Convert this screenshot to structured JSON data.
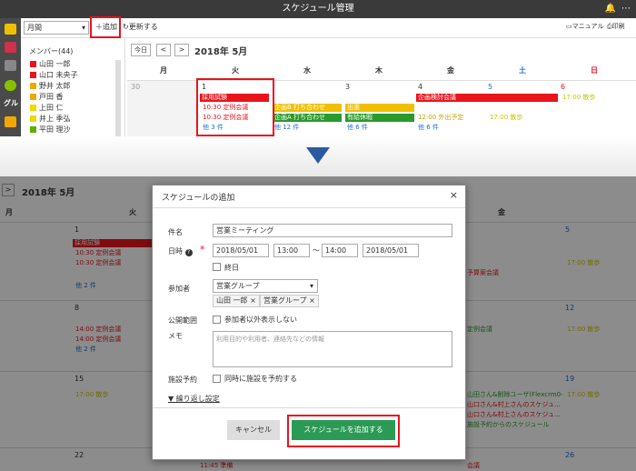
{
  "app": {
    "title": "スケジュール管理"
  },
  "toolbar": {
    "view": "月間",
    "add": "追加",
    "refresh": "更新する",
    "manual": "マニュアル",
    "print": "印刷"
  },
  "rail": {
    "guru": "グル"
  },
  "sidebar": {
    "title": "メンバー(44)",
    "members": [
      {
        "name": "山田 一郎",
        "color": "#e8141c"
      },
      {
        "name": "山口 未央子",
        "color": "#e8141c"
      },
      {
        "name": "野井 太郎",
        "color": "#f0a800"
      },
      {
        "name": "戸田 香",
        "color": "#f0a800"
      },
      {
        "name": "上田 仁",
        "color": "#f0d800"
      },
      {
        "name": "井上 季弘",
        "color": "#f0d800"
      },
      {
        "name": "平田 理沙",
        "color": "#5bb000"
      }
    ]
  },
  "cal": {
    "today": "今日",
    "prev": "<",
    "next": ">",
    "month": "2018年 5月",
    "dows": [
      "月",
      "火",
      "水",
      "木",
      "金",
      "土",
      "日"
    ],
    "w1": {
      "d30": "30",
      "d1": "1",
      "d3": "3",
      "d4": "4",
      "d5": "5",
      "d6": "6"
    },
    "ev": {
      "saiyo": "採用試験",
      "kikaku": "企画検討会議",
      "tei1": "10:30 定例会議",
      "tei2": "10:30 定例会議",
      "more3": "他 3 件",
      "uchi": "企画B 打ち合わせ",
      "uchiA": "企画A 打ち合わせ",
      "more12": "他 12 件",
      "shutcho": "出張",
      "yukyu": "有給休暇",
      "more6a": "他 6 件",
      "gaishutsu": "12:00 外出予定",
      "more6b": "他 6 件",
      "sanpo1": "17:00 散歩",
      "sanpo2": "17:00 散歩"
    }
  },
  "lower": {
    "month": "2018年 5月",
    "hi": "月",
    "ka": "火",
    "kin": "金",
    "c1": "1",
    "c5": "5",
    "c8": "8",
    "c12": "12",
    "c15": "15",
    "c19": "19",
    "c22": "22",
    "c26": "26",
    "saiyo": "採用試験",
    "tei1": "10:30 定例会議",
    "tei2": "10:30 定例会議",
    "more2a": "他 2 件",
    "t14a": "14:00 定例会議",
    "t14b": "14:00 定例会議",
    "more2b": "他 2 件",
    "sanpo": "17:00 散歩",
    "t1145": "11:45 準備",
    "kaigi": "会議",
    "kaigi2": "予算案会議",
    "sanpoR1": "17:00 散歩",
    "sanpoR2": "17:00 散歩",
    "sanpoR3": "17:00 散歩",
    "teiR": "定例会議",
    "r1": "山田さん&削除ユーザ(Flexcrm0-",
    "r2": "山口さん&村上さんのスケジュ…",
    "r3": "山口さん&村上さんのスケジュ…",
    "r4": "施設予約からのスケジュール",
    "kaiR": "会議"
  },
  "dialog": {
    "title": "スケジュールの追加",
    "close": "×",
    "subject_label": "件名",
    "subject": "営業ミーティング",
    "datetime_label": "日時",
    "start_date": "2018/05/01",
    "start_time": "13:00",
    "tilde": "〜",
    "end_time": "14:00",
    "end_date": "2018/05/01",
    "allday": "終日",
    "participants_label": "参加者",
    "group": "営業グループ",
    "tag1": "山田 一郎",
    "tag2": "営業グループ",
    "scope_label": "公開範囲",
    "scope_check": "参加者以外表示しない",
    "memo_label": "メモ",
    "memo_placeholder": "利用目的や利用者、連絡先などの情報",
    "facility_label": "施設予約",
    "facility_check": "同時に施設を予約する",
    "repeat": "▼ 繰り返し設定",
    "cancel": "キャンセル",
    "submit": "スケジュールを追加する"
  }
}
